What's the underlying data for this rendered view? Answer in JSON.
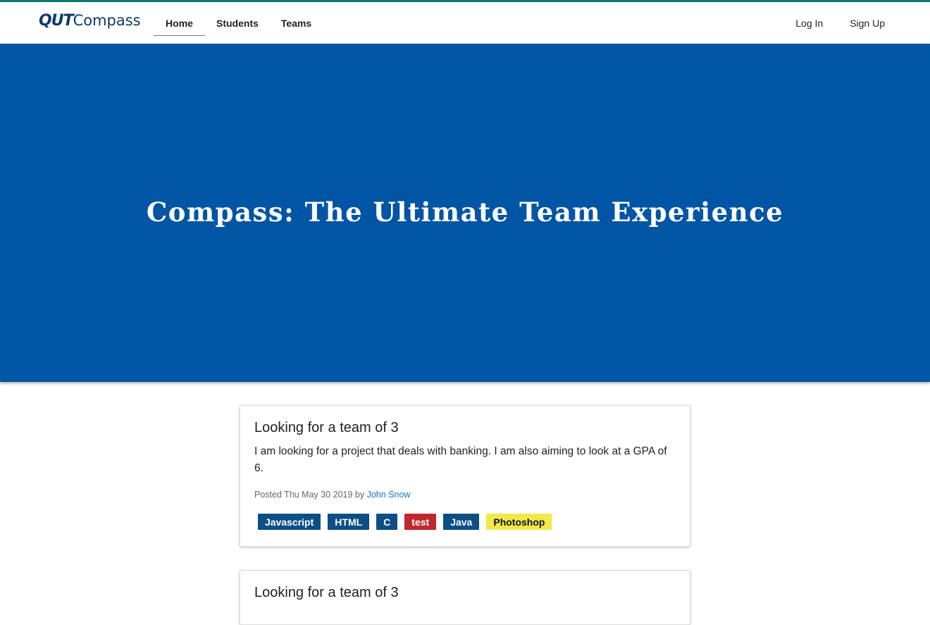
{
  "brand": {
    "logo_mark": "QUT",
    "logo_name": "Compass",
    "color": "#0b3a6e"
  },
  "nav": {
    "home": "Home",
    "students": "Students",
    "teams": "Teams"
  },
  "auth": {
    "login": "Log In",
    "signup": "Sign Up"
  },
  "hero": {
    "title": "Compass: The Ultimate Team Experience",
    "background": "#0055a5"
  },
  "posts": [
    {
      "title": "Looking for a team of 3",
      "body": "I am looking for a project that deals with banking. I am also aiming to look at a GPA of 6.",
      "posted_prefix": "Posted Thu May 30 2019 by",
      "author": "John Snow",
      "tags": [
        {
          "label": "Javascript",
          "color": "#0b4f86",
          "text_color": "#ffffff"
        },
        {
          "label": "HTML",
          "color": "#0b4f86",
          "text_color": "#ffffff"
        },
        {
          "label": "C",
          "color": "#0b4f86",
          "text_color": "#ffffff"
        },
        {
          "label": "test",
          "color": "#c0282d",
          "text_color": "#ffffff"
        },
        {
          "label": "Java",
          "color": "#0b4f86",
          "text_color": "#ffffff"
        },
        {
          "label": "Photoshop",
          "color": "#f3e84a",
          "text_color": "#111111"
        }
      ]
    },
    {
      "title": "Looking for a team of 3"
    }
  ]
}
